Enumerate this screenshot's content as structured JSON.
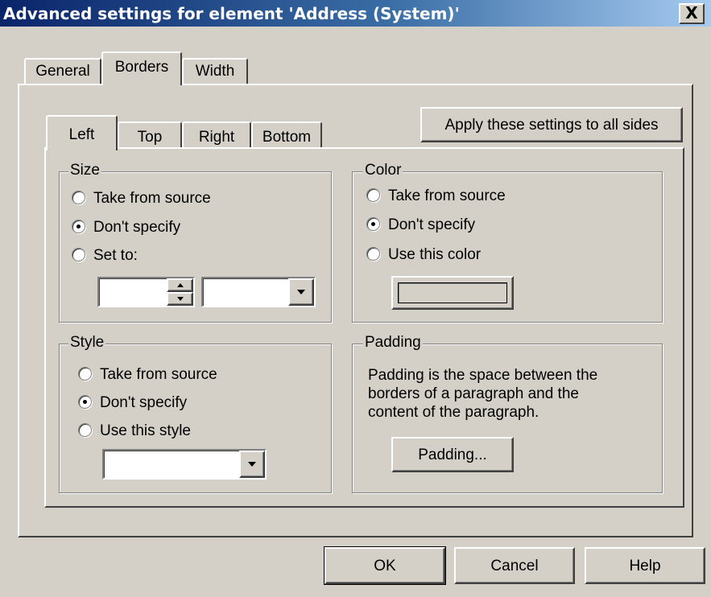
{
  "window": {
    "title": "Advanced settings for element 'Address (System)'",
    "close_label": "X"
  },
  "tabs": [
    {
      "label": "General",
      "active": false
    },
    {
      "label": "Borders",
      "active": true
    },
    {
      "label": "Width",
      "active": false
    }
  ],
  "side_tabs": [
    {
      "label": "Left",
      "active": true
    },
    {
      "label": "Top",
      "active": false
    },
    {
      "label": "Right",
      "active": false
    },
    {
      "label": "Bottom",
      "active": false
    }
  ],
  "apply_all_label": "Apply these settings to all sides",
  "size_group": {
    "title": "Size",
    "options": [
      "Take from source",
      "Don't specify",
      "Set to:"
    ],
    "selected": "Don't specify",
    "value": "",
    "unit": ""
  },
  "color_group": {
    "title": "Color",
    "options": [
      "Take from source",
      "Don't specify",
      "Use this color"
    ],
    "selected": "Don't specify"
  },
  "style_group": {
    "title": "Style",
    "options": [
      "Take from source",
      "Don't specify",
      "Use this style"
    ],
    "selected": "Don't specify",
    "value": ""
  },
  "padding_group": {
    "title": "Padding",
    "description_lines": [
      "Padding is the space between the",
      "borders of a paragraph and the",
      "content of the paragraph."
    ],
    "button_label": "Padding..."
  },
  "footer": {
    "ok_label": "OK",
    "cancel_label": "Cancel",
    "help_label": "Help"
  },
  "colors": {
    "title_gradient_start": "#0a246a",
    "title_gradient_end": "#a6caf0",
    "face": "#d4d0c8"
  }
}
